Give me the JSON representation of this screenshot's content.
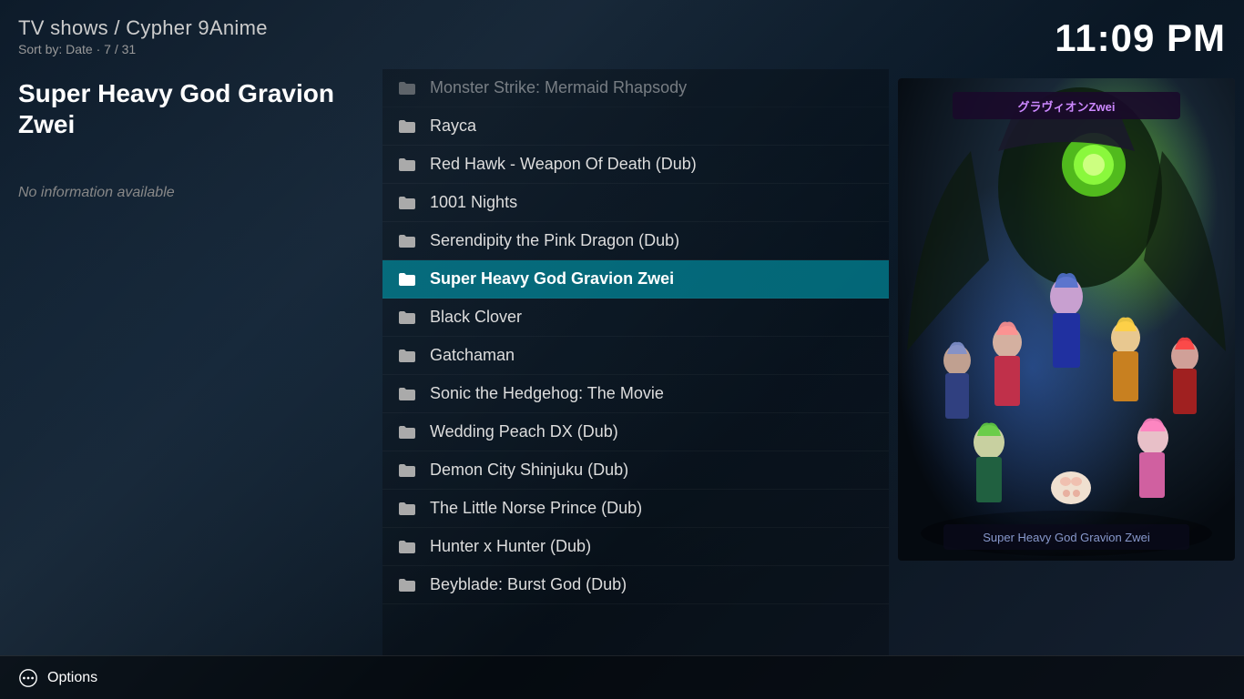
{
  "header": {
    "breadcrumb": "TV shows / Cypher 9Anime",
    "sort_info": "Sort by: Date · 7 / 31",
    "clock": "11:09 PM"
  },
  "selected_item": {
    "title": "Super Heavy God Gravion Zwei",
    "no_info_text": "No information available"
  },
  "list": {
    "items": [
      {
        "id": 0,
        "label": "Monster Strike: Mermaid Rhapsody",
        "selected": false,
        "faded": true
      },
      {
        "id": 1,
        "label": "Rayca",
        "selected": false,
        "faded": false
      },
      {
        "id": 2,
        "label": "Red Hawk - Weapon Of Death (Dub)",
        "selected": false,
        "faded": false
      },
      {
        "id": 3,
        "label": "1001 Nights",
        "selected": false,
        "faded": false
      },
      {
        "id": 4,
        "label": "Serendipity the Pink Dragon (Dub)",
        "selected": false,
        "faded": false
      },
      {
        "id": 5,
        "label": "Super Heavy God Gravion Zwei",
        "selected": true,
        "faded": false
      },
      {
        "id": 6,
        "label": "Black Clover",
        "selected": false,
        "faded": false
      },
      {
        "id": 7,
        "label": "Gatchaman",
        "selected": false,
        "faded": false
      },
      {
        "id": 8,
        "label": "Sonic the Hedgehog: The Movie",
        "selected": false,
        "faded": false
      },
      {
        "id": 9,
        "label": "Wedding Peach DX (Dub)",
        "selected": false,
        "faded": false
      },
      {
        "id": 10,
        "label": "Demon City Shinjuku (Dub)",
        "selected": false,
        "faded": false
      },
      {
        "id": 11,
        "label": "The Little Norse Prince (Dub)",
        "selected": false,
        "faded": false
      },
      {
        "id": 12,
        "label": "Hunter x Hunter (Dub)",
        "selected": false,
        "faded": false
      },
      {
        "id": 13,
        "label": "Beyblade: Burst God (Dub)",
        "selected": false,
        "faded": false
      }
    ]
  },
  "bottom_bar": {
    "options_label": "Options"
  }
}
